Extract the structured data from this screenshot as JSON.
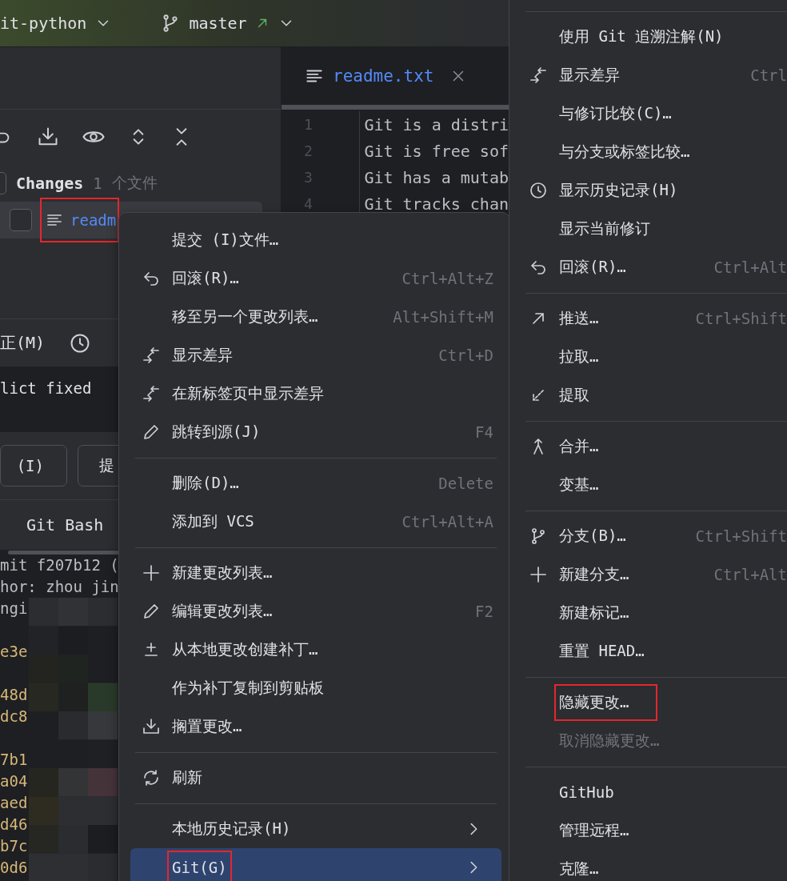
{
  "toolbar": {
    "project": "it-python",
    "branch": "master"
  },
  "changes_panel": {
    "group": {
      "label": "Changes",
      "count": "1",
      "unit": "个文件",
      "checked": false
    },
    "file": {
      "name": "readm",
      "checked": false,
      "selected": true,
      "highlighted": true
    },
    "amend_label": "正(M)",
    "commit_message": "lict fixed",
    "buttons": [
      "(I)",
      "提"
    ]
  },
  "terminal": {
    "tab": "Git Bash",
    "lines": [
      {
        "text": "mit f207b12 (",
        "kind": "plain",
        "blank_before": false
      },
      {
        "text": "hor: zhou jin",
        "kind": "plain",
        "blank_before": false
      },
      {
        "text": "ngi",
        "kind": "plain",
        "blank_before": false
      },
      {
        "text": "e3e",
        "kind": "hash",
        "blank_before": true
      },
      {
        "text": "48d",
        "kind": "hash",
        "blank_before": true
      },
      {
        "text": "dc8",
        "kind": "hash",
        "blank_before": false
      },
      {
        "text": "7b1",
        "kind": "hash",
        "blank_before": true
      },
      {
        "text": "a04",
        "kind": "hash",
        "blank_before": false
      },
      {
        "text": "aed",
        "kind": "hash",
        "blank_before": false
      },
      {
        "text": "d46",
        "kind": "hash",
        "blank_before": false
      },
      {
        "text": "b7c",
        "kind": "hash",
        "blank_before": false
      },
      {
        "text": "0d6",
        "kind": "hash",
        "blank_before": false
      }
    ]
  },
  "editor": {
    "tab": {
      "name": "readme.txt"
    },
    "lines": [
      {
        "number": "1",
        "text": "Git is a distri"
      },
      {
        "number": "2",
        "text": "Git is free sof"
      },
      {
        "number": "3",
        "text": "Git has a mutab"
      },
      {
        "number": "4",
        "text": "Git tracks chan"
      }
    ]
  },
  "context_menu": {
    "groups": [
      [
        {
          "label": "提交 (I)文件…",
          "selected": false
        },
        {
          "label": "回滚(R)…",
          "shortcut": "Ctrl+Alt+Z",
          "selected": false
        },
        {
          "label": "移至另一个更改列表…",
          "shortcut": "Alt+Shift+M",
          "selected": false
        },
        {
          "label": "显示差异",
          "shortcut": "Ctrl+D",
          "selected": false
        },
        {
          "label": "在新标签页中显示差异",
          "selected": false
        },
        {
          "label": "跳转到源(J)",
          "shortcut": "F4",
          "selected": false
        }
      ],
      [
        {
          "label": "删除(D)…",
          "shortcut": "Delete",
          "selected": false
        },
        {
          "label": "添加到 VCS",
          "shortcut": "Ctrl+Alt+A",
          "selected": false
        }
      ],
      [
        {
          "label": "新建更改列表…",
          "selected": false
        },
        {
          "label": "编辑更改列表…",
          "shortcut": "F2",
          "selected": false
        },
        {
          "label": "从本地更改创建补丁…",
          "selected": false
        },
        {
          "label": "作为补丁复制到剪贴板",
          "selected": false
        },
        {
          "label": "搁置更改…",
          "selected": false
        }
      ],
      [
        {
          "label": "刷新",
          "selected": false
        }
      ],
      [
        {
          "label": "本地历史记录(H)",
          "submenu": true,
          "selected": false
        },
        {
          "label": "Git(G)",
          "submenu": true,
          "selected": true,
          "highlighted": true
        }
      ]
    ]
  },
  "git_submenu": {
    "groups": [
      [
        {
          "label": "使用 Git 追溯注解(N)"
        },
        {
          "label": "显示差异",
          "shortcut": "Ctrl"
        },
        {
          "label": "与修订比较(C)…"
        },
        {
          "label": "与分支或标签比较…"
        },
        {
          "label": "显示历史记录(H)"
        },
        {
          "label": "显示当前修订"
        },
        {
          "label": "回滚(R)…",
          "shortcut": "Ctrl+Alt"
        }
      ],
      [
        {
          "label": "推送…",
          "shortcut": "Ctrl+Shift"
        },
        {
          "label": "拉取…"
        },
        {
          "label": "提取"
        }
      ],
      [
        {
          "label": "合并…"
        },
        {
          "label": "变基…"
        }
      ],
      [
        {
          "label": "分支(B)…",
          "shortcut": "Ctrl+Shift"
        },
        {
          "label": "新建分支…",
          "shortcut": "Ctrl+Alt"
        },
        {
          "label": "新建标记…"
        },
        {
          "label": "重置 HEAD…"
        }
      ],
      [
        {
          "label": "隐藏更改…",
          "highlighted": true
        },
        {
          "label": "取消隐藏更改…",
          "disabled": true
        }
      ],
      [
        {
          "label": "GitHub"
        },
        {
          "label": "管理远程…"
        },
        {
          "label": "克隆…"
        }
      ]
    ]
  }
}
